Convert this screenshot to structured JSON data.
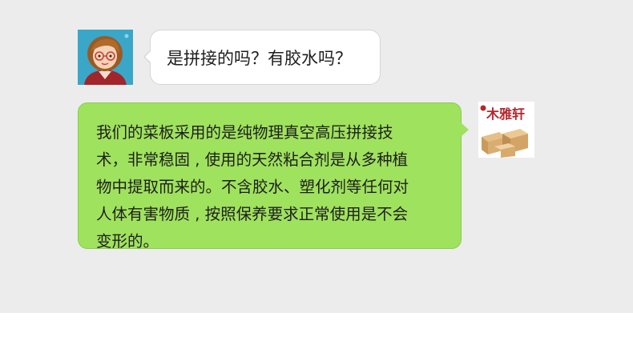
{
  "messages": [
    {
      "side": "left",
      "avatar": "cartoon-woman-avatar",
      "text": "是拼接的吗？有胶水吗？"
    },
    {
      "side": "right",
      "avatar": "brand-logo-avatar",
      "brand_logo_text": "木雅轩",
      "lines": [
        "我们的菜板采用的是纯物理真空高压拼接技",
        "术，非常稳固 , 使用的天然粘合剂是从多种植",
        "物中提取而来的。不含胶水、塑化剂等任何对",
        "人体有害物质 , 按照保养要求正常使用是不会",
        "变形的。"
      ]
    }
  ],
  "colors": {
    "chat_background": "#ececec",
    "incoming_bubble": "#ffffff",
    "outgoing_bubble": "#9fe25e",
    "avatar_left_bg": "#3aa6c8",
    "logo_red": "#b3282d"
  }
}
